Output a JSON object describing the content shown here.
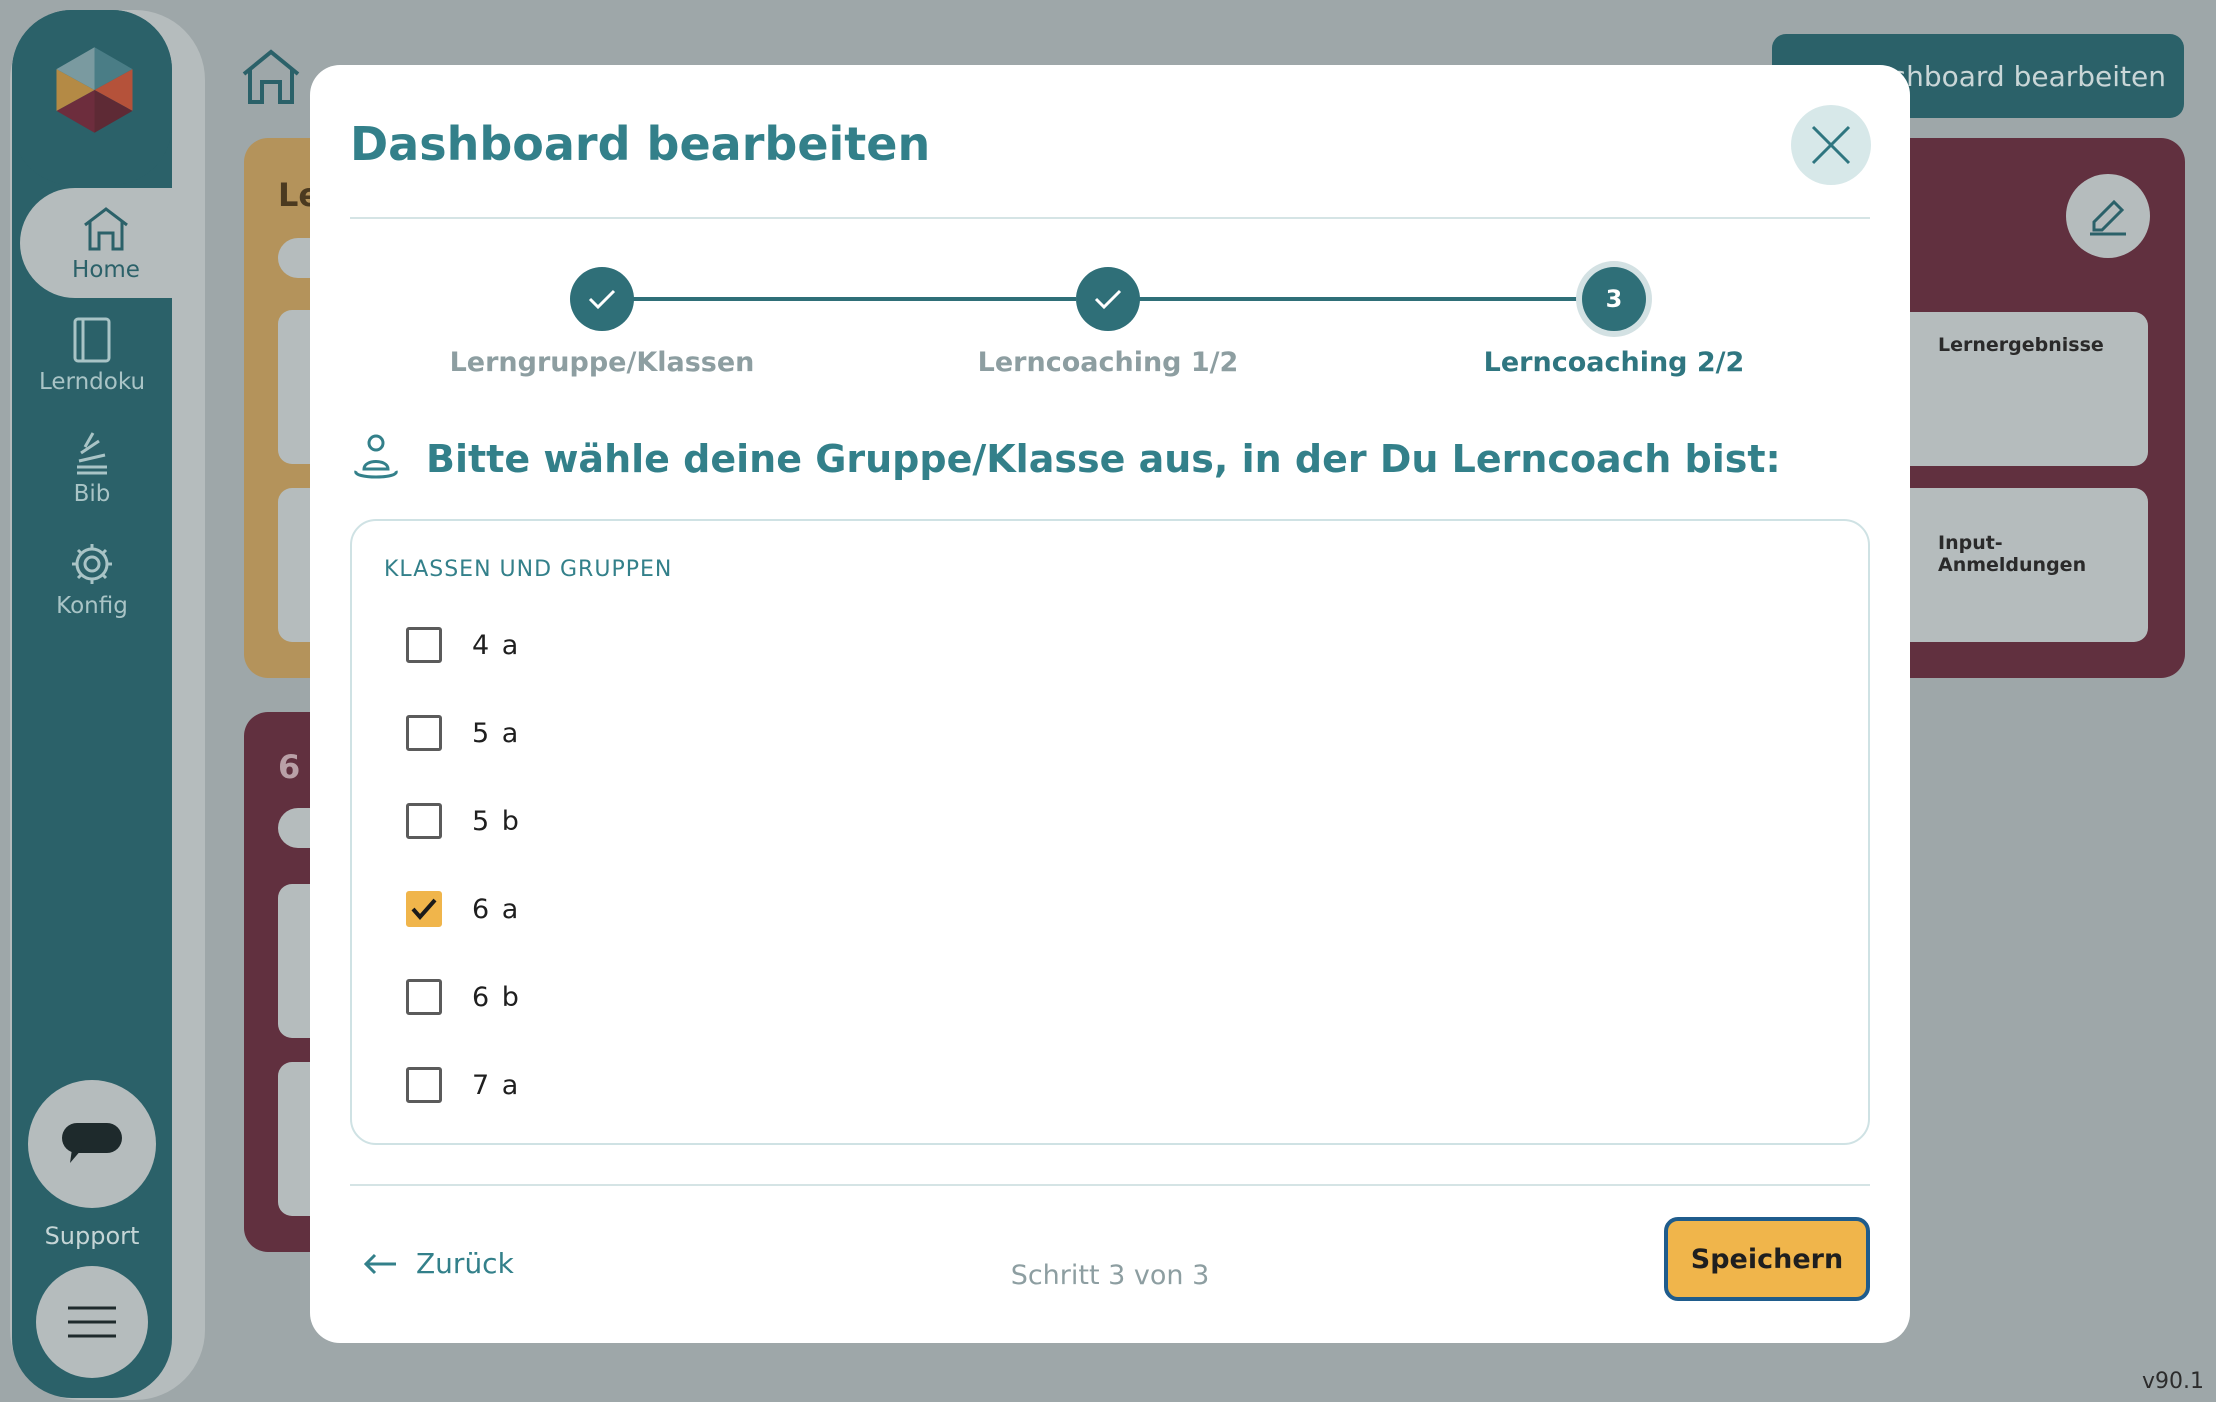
{
  "sidebar": {
    "items": [
      {
        "label": "Home",
        "icon": "home-icon",
        "active": true
      },
      {
        "label": "Lerndoku",
        "icon": "book-icon",
        "active": false
      },
      {
        "label": "Bib",
        "icon": "library-icon",
        "active": false
      },
      {
        "label": "Konfig",
        "icon": "gear-icon",
        "active": false
      }
    ],
    "support_label": "Support"
  },
  "background": {
    "edit_button_label": "shboard bearbeiten",
    "yellow_card_title": "Le",
    "purple_card_title": "6",
    "tiles": [
      "Lernergebnisse",
      "Input-\nAnmeldungen"
    ],
    "version": "v90.1"
  },
  "modal": {
    "title": "Dashboard bearbeiten",
    "steps": [
      {
        "label": "Lerngruppe/Klassen",
        "state": "done"
      },
      {
        "label": "Lerncoaching 1/2",
        "state": "done"
      },
      {
        "label": "Lerncoaching 2/2",
        "state": "current",
        "number": "3"
      }
    ],
    "question": "Bitte wähle deine Gruppe/Klasse aus, in der Du Lerncoach bist:",
    "box_header": "KLASSEN UND GRUPPEN",
    "options": [
      {
        "label": "4 a",
        "checked": false
      },
      {
        "label": "5 a",
        "checked": false
      },
      {
        "label": "5 b",
        "checked": false
      },
      {
        "label": "6 a",
        "checked": true
      },
      {
        "label": "6 b",
        "checked": false
      },
      {
        "label": "7 a",
        "checked": false
      }
    ],
    "back_label": "Zurück",
    "step_counter": "Schritt 3 von 3",
    "save_label": "Speichern"
  },
  "colors": {
    "primary": "#33808a",
    "accent": "#f0b54b",
    "sidebar": "#2b6169"
  }
}
